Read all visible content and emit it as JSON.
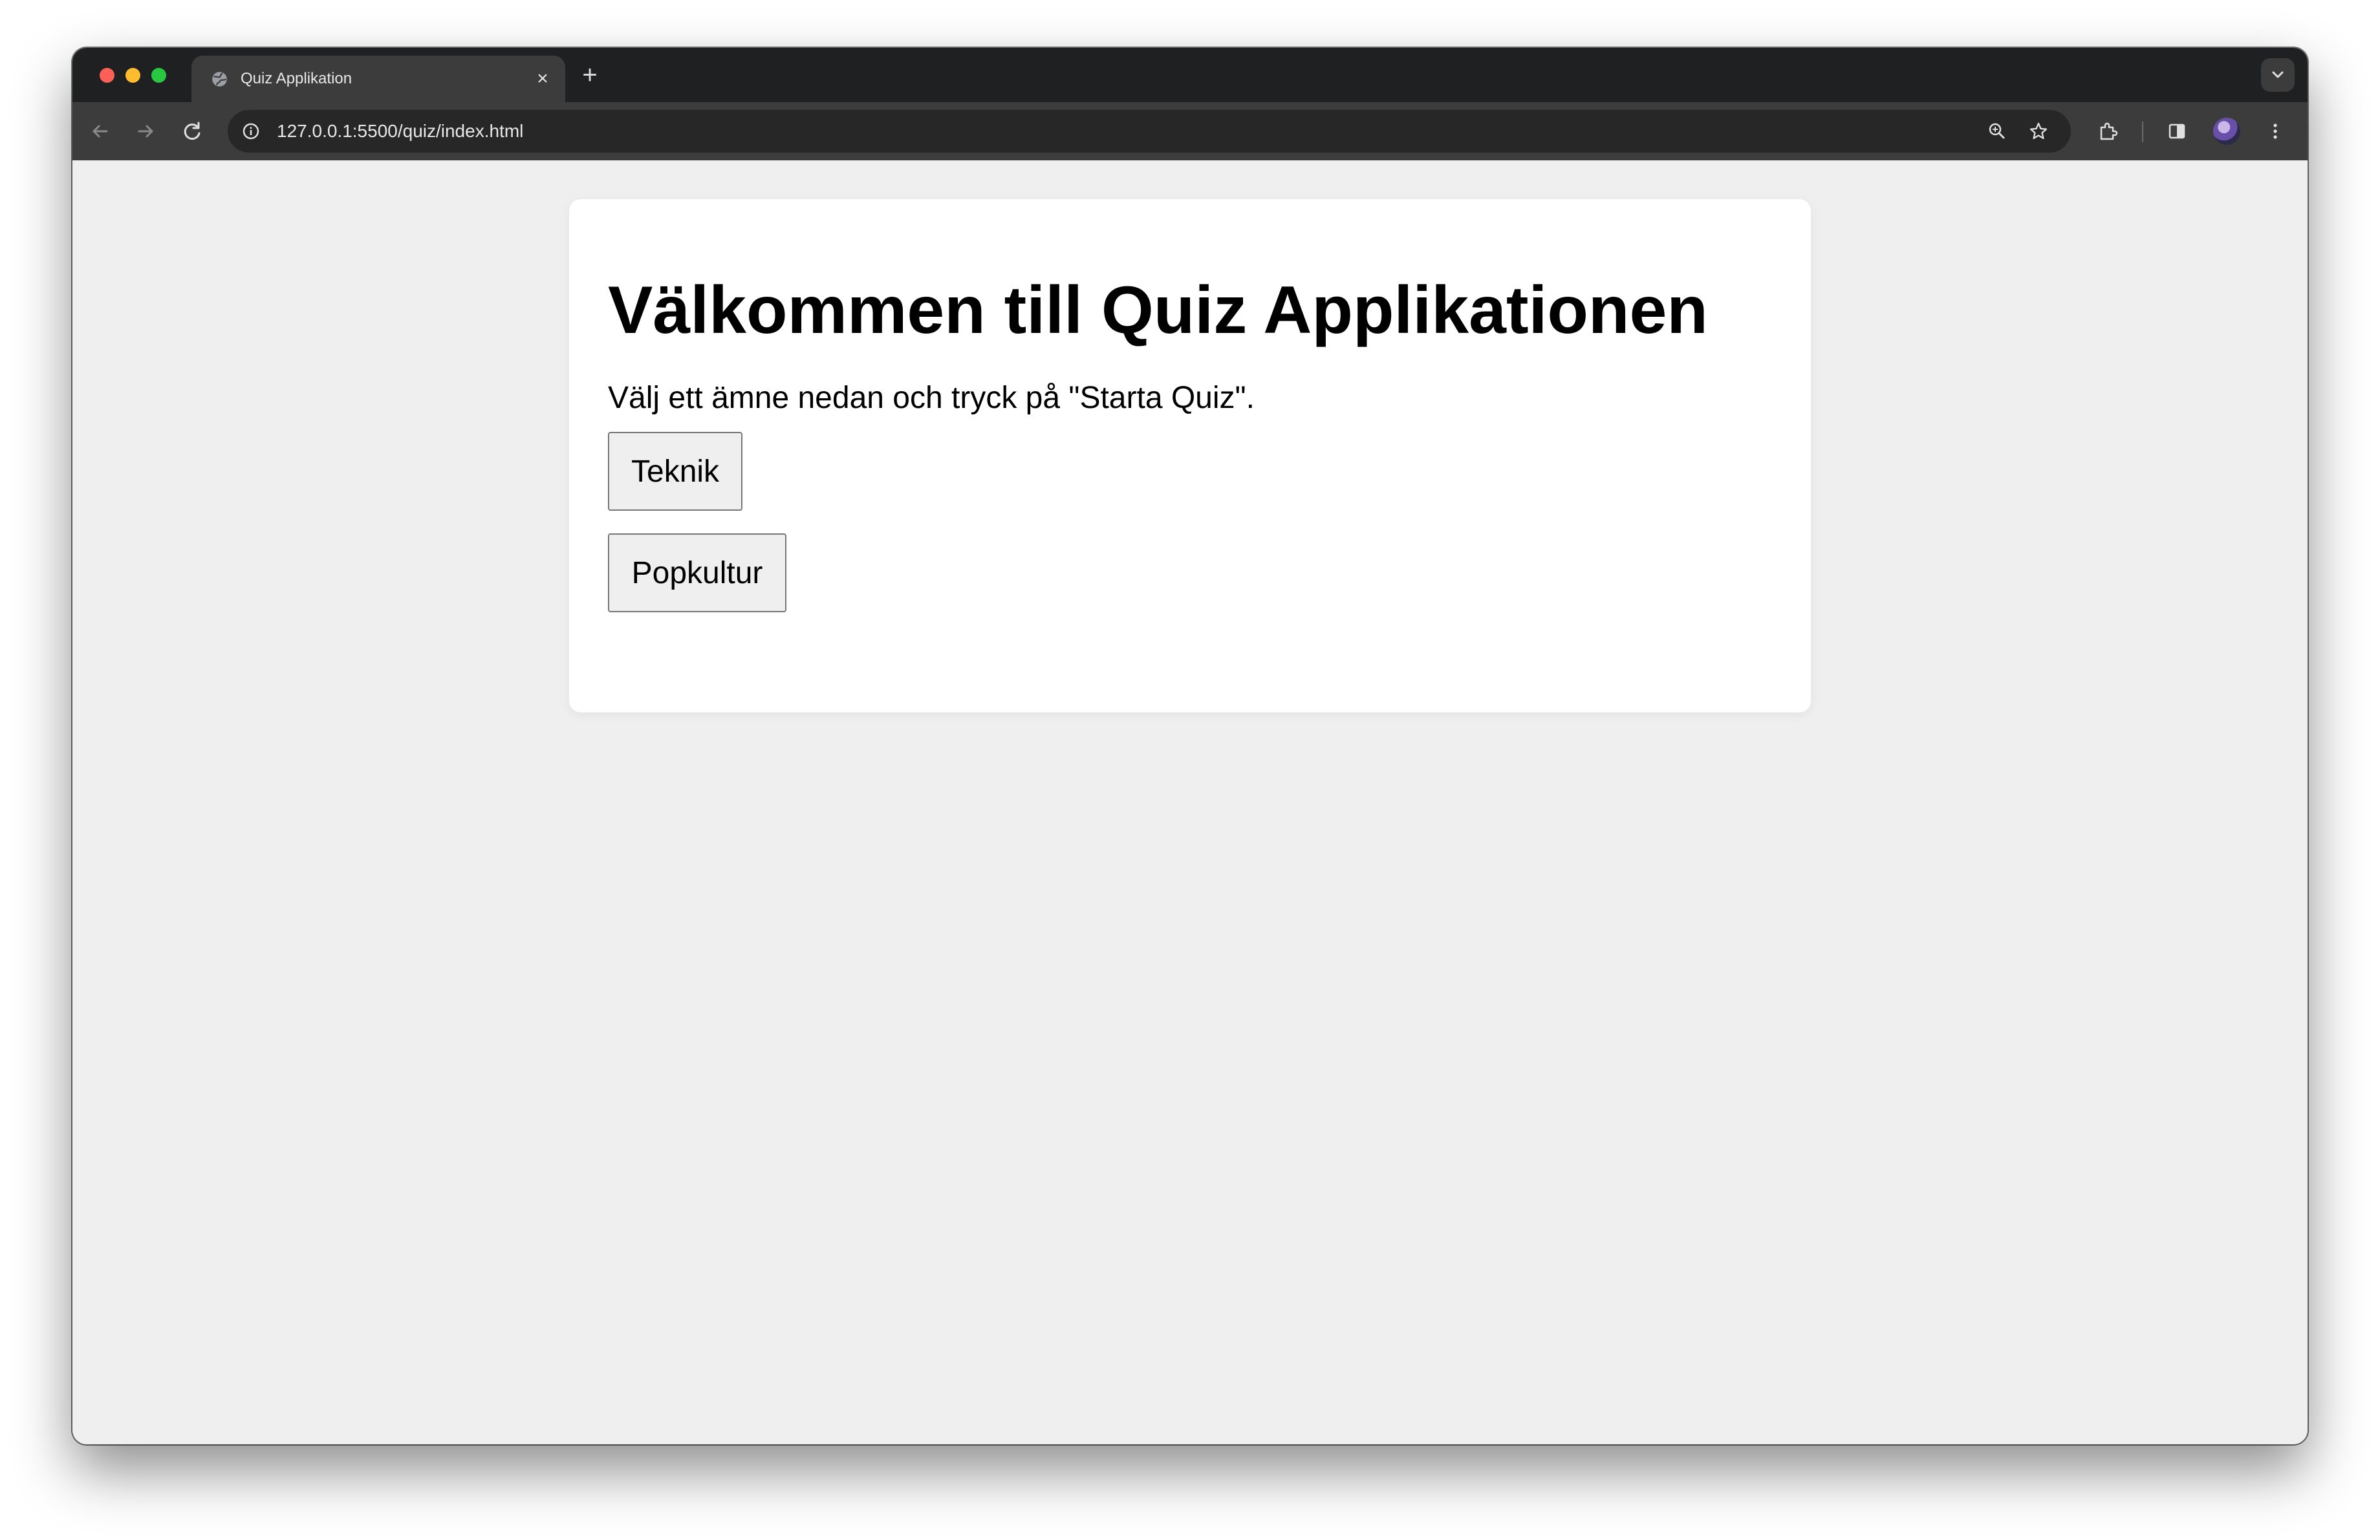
{
  "browser": {
    "tab_title": "Quiz Applikation",
    "url": "127.0.0.1:5500/quiz/index.html",
    "tab_close_symbol": "×",
    "new_tab_symbol": "+",
    "icons": [
      "globe-icon",
      "close-icon",
      "plus-icon",
      "chevron-down-icon",
      "back-arrow-icon",
      "forward-arrow-icon",
      "reload-icon",
      "info-icon",
      "zoom-icon",
      "star-icon",
      "extensions-icon",
      "side-panel-icon",
      "avatar",
      "kebab-menu-icon"
    ]
  },
  "page": {
    "heading": "Välkommen till Quiz Applikationen",
    "instruction": "Välj ett ämne nedan och tryck på \"Starta Quiz\".",
    "topics": [
      {
        "label": "Teknik"
      },
      {
        "label": "Popkultur"
      }
    ]
  },
  "colors": {
    "page_background": "#efefef",
    "card_background": "#ffffff",
    "button_background": "#efefef",
    "chrome_dark": "#1f2021",
    "toolbar": "#3c3c3c"
  }
}
